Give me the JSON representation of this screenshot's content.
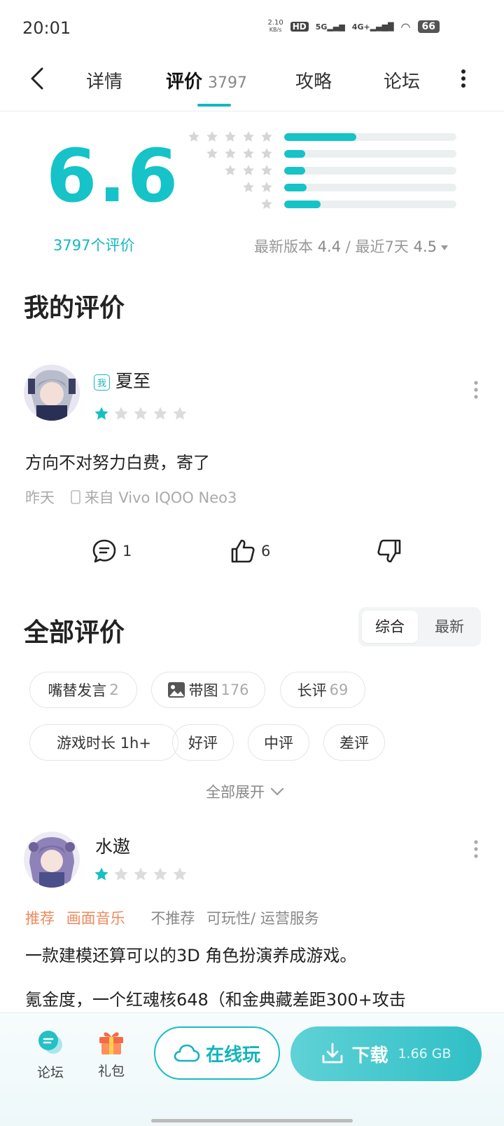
{
  "status": {
    "time": "20:01",
    "speed_top": "2.10",
    "speed_unit": "KB/s",
    "hd": "HD",
    "net1": "5G",
    "net2": "4G+",
    "battery": "66"
  },
  "tabs": [
    {
      "label": "详情"
    },
    {
      "label": "评价",
      "count": "3797"
    },
    {
      "label": "攻略"
    },
    {
      "label": "论坛"
    }
  ],
  "rating": {
    "score": "6.6",
    "count_text": "3797个评价",
    "distribution": [
      {
        "stars": 5,
        "fraction": 0.42
      },
      {
        "stars": 4,
        "fraction": 0.12
      },
      {
        "stars": 3,
        "fraction": 0.12
      },
      {
        "stars": 2,
        "fraction": 0.13
      },
      {
        "stars": 1,
        "fraction": 0.21
      }
    ],
    "latest_version_label": "最新版本",
    "latest_version_value": "4.4",
    "separator": "/",
    "recent_label": "最近7天",
    "recent_value": "4.5"
  },
  "my_review": {
    "section_title": "我的评价",
    "badge": "我",
    "user": "夏至",
    "stars": 1,
    "text": "方向不对努力白费，寄了",
    "time": "昨天",
    "device": "来自 Vivo IQOO Neo3",
    "comments": "1",
    "likes": "6"
  },
  "all_reviews": {
    "section_title": "全部评价",
    "sort_options": [
      "综合",
      "最新"
    ],
    "sort_selected": "综合",
    "chips": [
      {
        "label": "嘴替发言",
        "count": "2"
      },
      {
        "label": "带图",
        "count": "176",
        "icon": "image-icon"
      },
      {
        "label": "长评",
        "count": "69"
      },
      {
        "label": "游戏时长 1h+"
      },
      {
        "label": "好评"
      },
      {
        "label": "中评"
      },
      {
        "label": "差评"
      }
    ],
    "expand_label": "全部展开"
  },
  "review2": {
    "user": "水遨",
    "stars": 1,
    "recommend_label": "推荐",
    "recommend_tags": "画面音乐",
    "not_recommend_label": "不推荐",
    "not_recommend_tags": "可玩性/ 运营服务",
    "line1": "一款建模还算可以的3D 角色扮演养成游戏。",
    "line2": "氪金度，一个红魂核648（和金典藏差距300+攻击"
  },
  "bottom": {
    "forum": "论坛",
    "gift": "礼包",
    "play_online": "在线玩",
    "download": "下载",
    "size": "1.66 GB"
  },
  "colors": {
    "accent": "#15c3c8",
    "recommend": "#f08a5d"
  }
}
